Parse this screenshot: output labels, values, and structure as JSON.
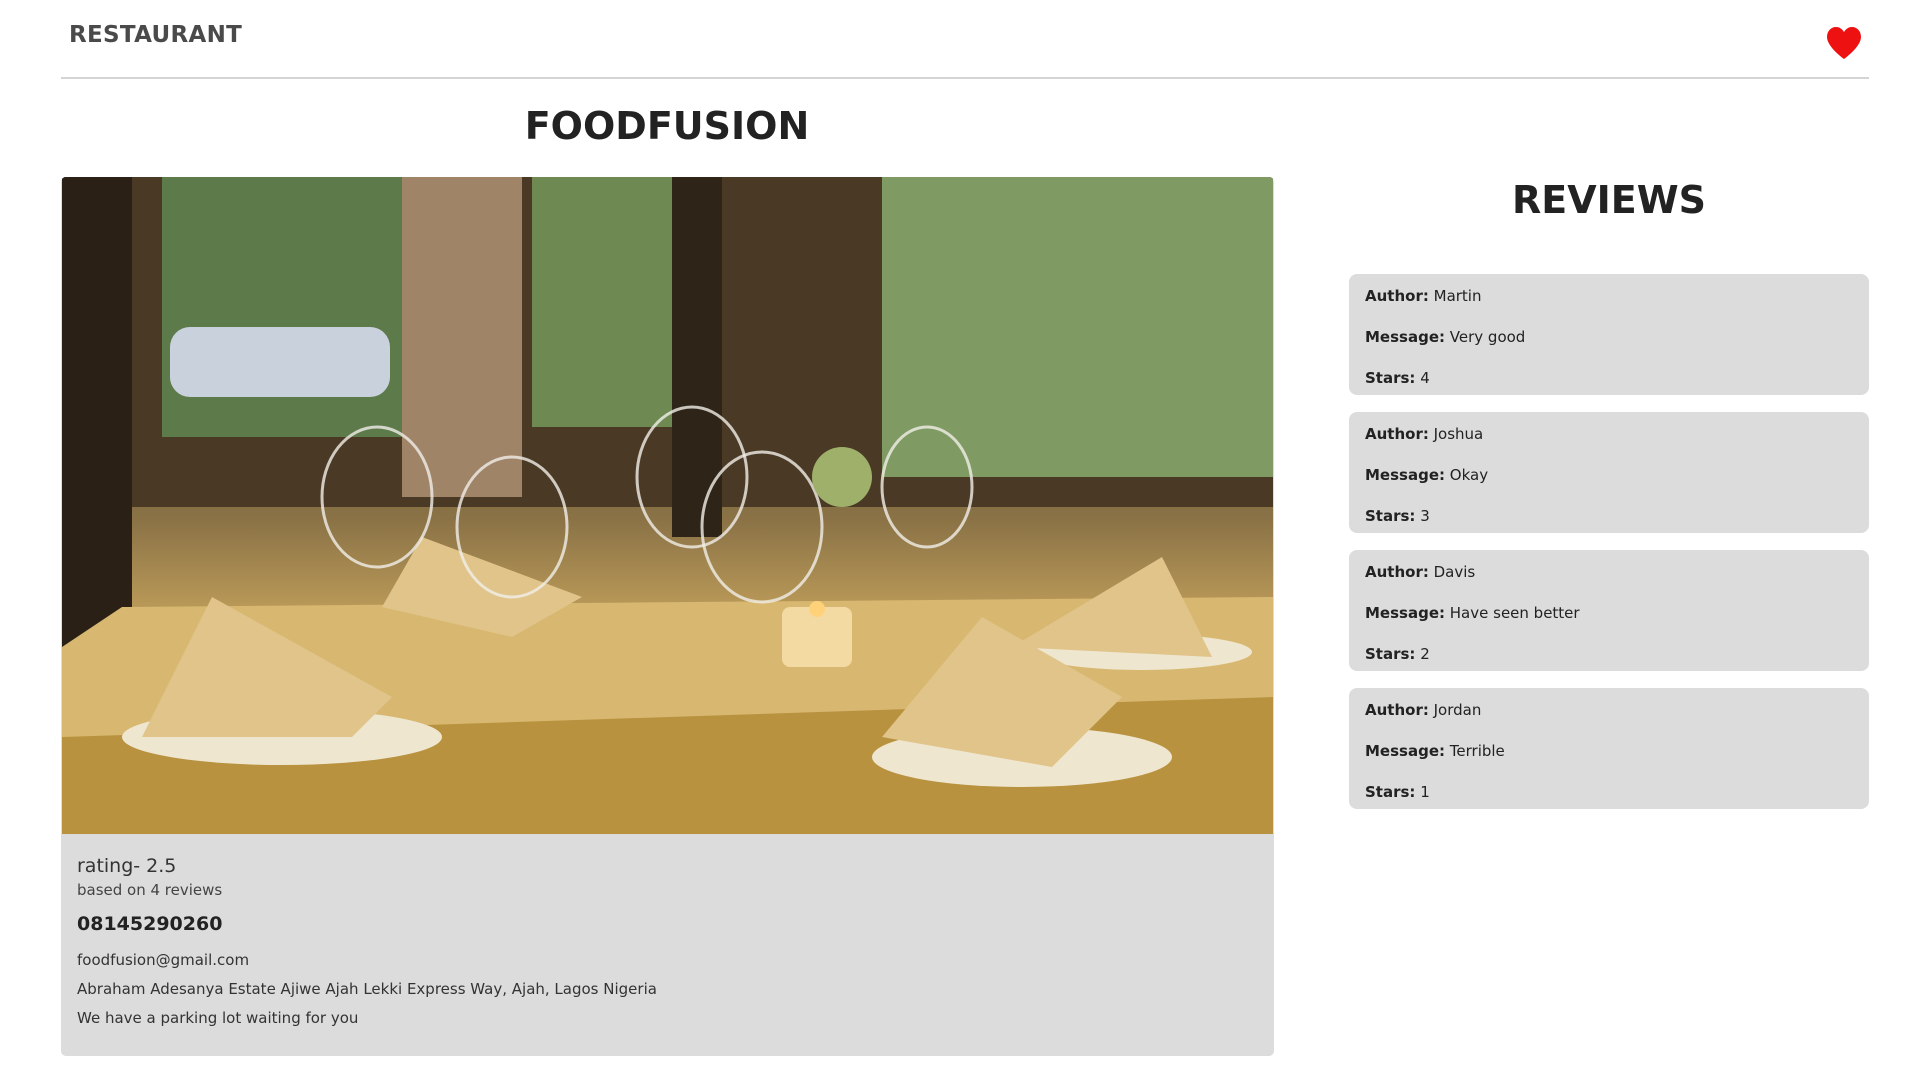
{
  "navbar": {
    "brand": "RESTAURANT",
    "favorite_icon": "heart-icon",
    "favorite_color": "#ee1111"
  },
  "restaurant": {
    "name": "FOODFUSION",
    "rating_text": "rating- 2.5",
    "based_on": "based on 4 reviews",
    "phone": "08145290260",
    "email": "foodfusion@gmail.com",
    "address": "Abraham Adesanya Estate Ajiwe Ajah Lekki Express Way, Ajah, Lagos Nigeria",
    "note": "We have a parking lot waiting for you"
  },
  "reviews": {
    "title": "REVIEWS",
    "author_label": "Author:",
    "message_label": "Message:",
    "stars_label": "Stars:",
    "items": [
      {
        "author": "Martin",
        "message": "Very good",
        "stars": "4"
      },
      {
        "author": "Joshua",
        "message": "Okay",
        "stars": "3"
      },
      {
        "author": "Davis",
        "message": "Have seen better",
        "stars": "2"
      },
      {
        "author": "Jordan",
        "message": "Terrible",
        "stars": "1"
      }
    ]
  },
  "colors": {
    "card_bg": "#dcdcdc",
    "divider": "#d4d4d4"
  }
}
